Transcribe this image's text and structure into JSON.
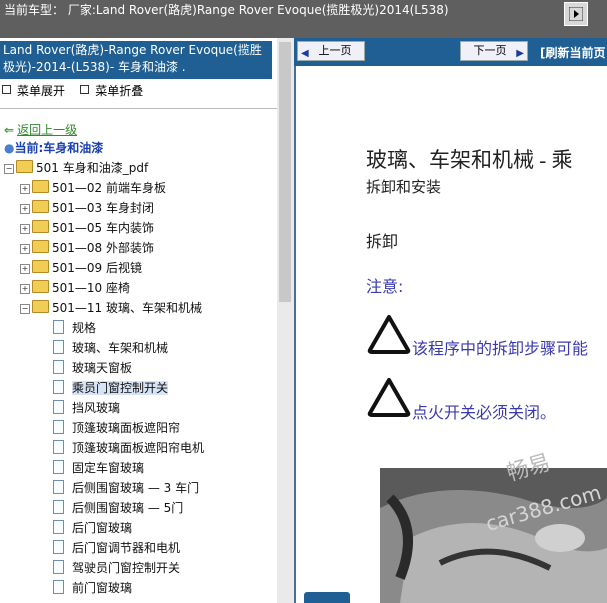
{
  "topbar": {
    "title": "当前车型： 厂家:Land Rover(路虎)Range Rover Evoque(揽胜极光)2014(L538)",
    "button_icon": "next-arrow-icon"
  },
  "left": {
    "header": "Land Rover(路虎)-Range Rover Evoque(揽胜极光)-2014-(L538)- 车身和油漆 .",
    "menu_expand": "菜单展开",
    "menu_collapse": "菜单折叠",
    "back": "返回上一级",
    "current": "当前:车身和油漆",
    "tree": [
      {
        "label": "501 车身和油漆_pdf",
        "level": 0,
        "type": "folder",
        "exp": "−"
      },
      {
        "label": "501—02 前端车身板",
        "level": 1,
        "type": "folder",
        "exp": "+"
      },
      {
        "label": "501—03 车身封闭",
        "level": 1,
        "type": "folder",
        "exp": "+"
      },
      {
        "label": "501—05 车内装饰",
        "level": 1,
        "type": "folder",
        "exp": "+"
      },
      {
        "label": "501—08 外部装饰",
        "level": 1,
        "type": "folder",
        "exp": "+"
      },
      {
        "label": "501—09 后视镜",
        "level": 1,
        "type": "folder",
        "exp": "+"
      },
      {
        "label": "501—10 座椅",
        "level": 1,
        "type": "folder",
        "exp": "+"
      },
      {
        "label": "501—11 玻璃、车架和机械",
        "level": 1,
        "type": "folder",
        "exp": "−"
      },
      {
        "label": "规格",
        "level": 2,
        "type": "doc"
      },
      {
        "label": "玻璃、车架和机械",
        "level": 2,
        "type": "doc"
      },
      {
        "label": "玻璃天窗板",
        "level": 2,
        "type": "doc"
      },
      {
        "label": "乘员门窗控制开关",
        "level": 2,
        "type": "doc",
        "selected": true
      },
      {
        "label": "挡风玻璃",
        "level": 2,
        "type": "doc"
      },
      {
        "label": "顶篷玻璃面板遮阳帘",
        "level": 2,
        "type": "doc"
      },
      {
        "label": "顶篷玻璃面板遮阳帘电机",
        "level": 2,
        "type": "doc"
      },
      {
        "label": "固定车窗玻璃",
        "level": 2,
        "type": "doc"
      },
      {
        "label": "后侧围窗玻璃 — 3 车门",
        "level": 2,
        "type": "doc"
      },
      {
        "label": "后侧围窗玻璃 — 5门",
        "level": 2,
        "type": "doc"
      },
      {
        "label": "后门窗玻璃",
        "level": 2,
        "type": "doc"
      },
      {
        "label": "后门窗调节器和电机",
        "level": 2,
        "type": "doc"
      },
      {
        "label": "驾驶员门窗控制开关",
        "level": 2,
        "type": "doc"
      },
      {
        "label": "前门窗玻璃",
        "level": 2,
        "type": "doc"
      }
    ]
  },
  "right": {
    "prev": "上一页",
    "next": "下一页",
    "refresh": "[刷新当前页",
    "heading": "玻璃、车架和机械 - 乘",
    "subheading": "拆卸和安装",
    "removal": "拆卸",
    "note": "注意:",
    "warning1": "该程序中的拆卸步骤可能",
    "warning2": "点火开关必须关闭。",
    "watermark1": "畅易",
    "watermark2": "car388.com"
  },
  "colors": {
    "header_blue": "#1f5f93",
    "topbar": "#5f5f5f",
    "note_text": "#3a3ab0"
  }
}
